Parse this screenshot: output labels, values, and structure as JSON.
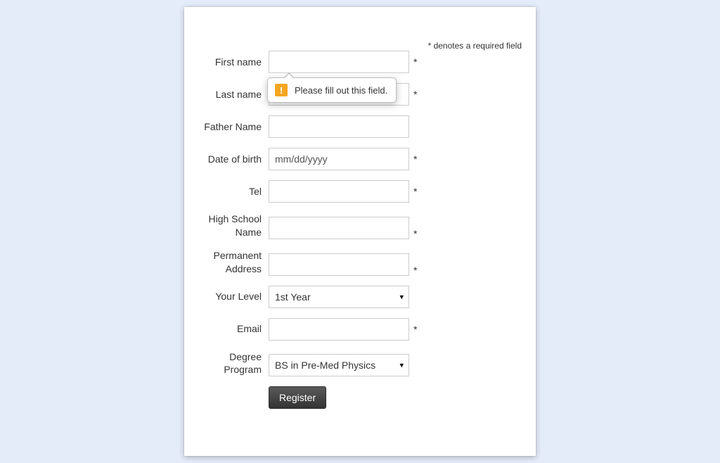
{
  "required_note": "* denotes a required field",
  "form": {
    "first_name": {
      "label": "First name",
      "value": "",
      "required": "*"
    },
    "last_name": {
      "label": "Last name",
      "value": "",
      "required": "*"
    },
    "father_name": {
      "label": "Father Name",
      "value": "",
      "required": ""
    },
    "dob": {
      "label": "Date of birth",
      "placeholder": "mm/dd/yyyy",
      "required": "*"
    },
    "tel": {
      "label": "Tel",
      "value": "",
      "required": "*"
    },
    "high_school": {
      "label": "High School Name",
      "value": "",
      "required": "*"
    },
    "address": {
      "label": "Permanent Address",
      "value": "",
      "required": "*"
    },
    "level": {
      "label": "Your Level",
      "selected": "1st Year",
      "required": ""
    },
    "email": {
      "label": "Email",
      "value": "",
      "required": "*"
    },
    "degree": {
      "label": "Degree Program",
      "selected": "BS in Pre-Med Physics",
      "required": ""
    },
    "submit_label": "Register"
  },
  "tooltip": {
    "icon": "warning-icon",
    "text": "Please fill out this field."
  }
}
